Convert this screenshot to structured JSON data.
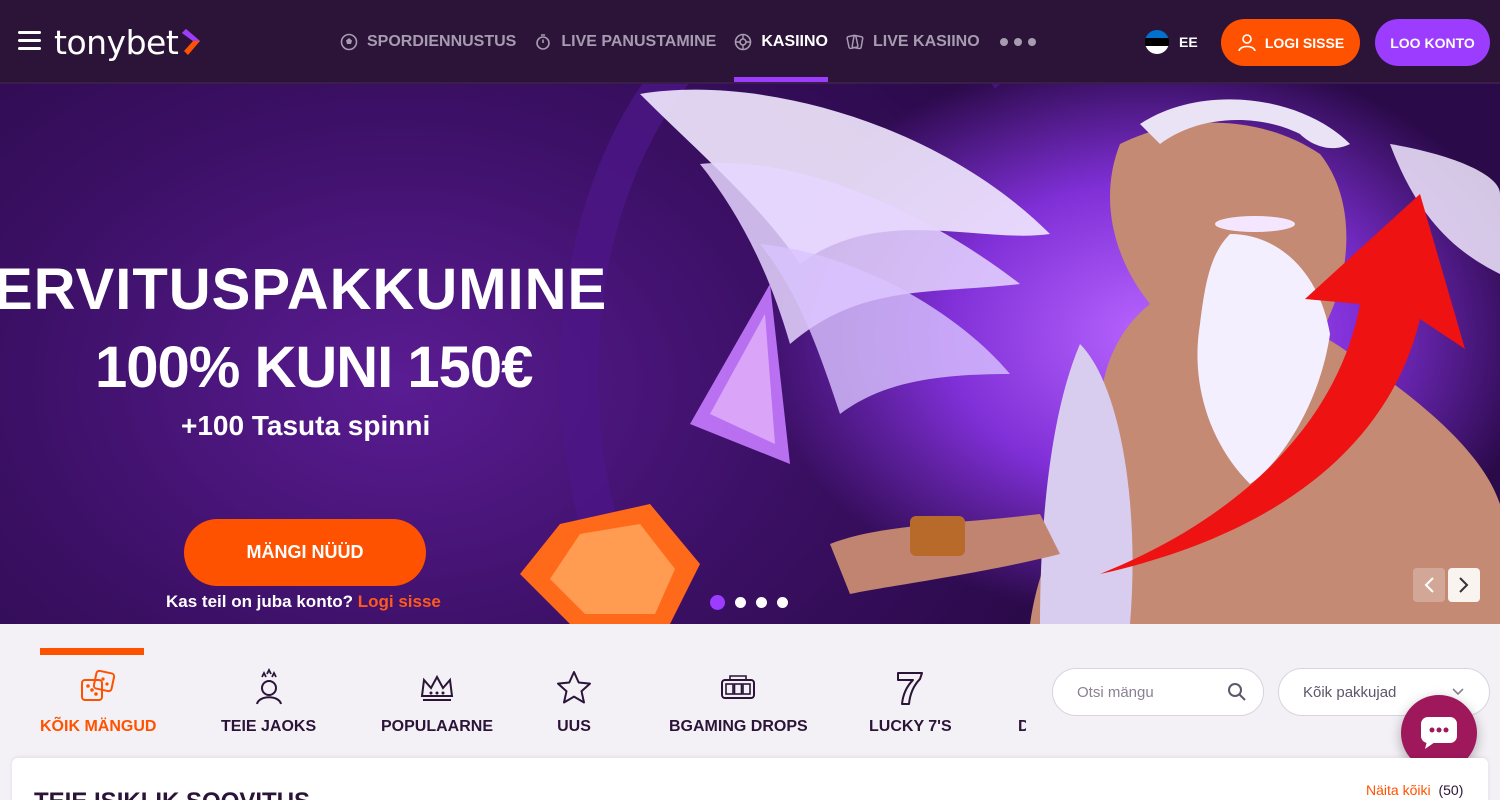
{
  "header": {
    "logo": "tonybet",
    "nav": [
      {
        "label": "SPORDIENNUSTUS",
        "icon": "soccer-ball-icon",
        "active": false
      },
      {
        "label": "LIVE PANUSTAMINE",
        "icon": "stopwatch-icon",
        "active": false
      },
      {
        "label": "KASIINO",
        "icon": "roulette-icon",
        "active": true
      },
      {
        "label": "LIVE KASIINO",
        "icon": "cards-icon",
        "active": false
      }
    ],
    "language": "EE",
    "login_label": "LOGI SISSE",
    "register_label": "LOO KONTO"
  },
  "hero": {
    "title": "ERVITUSPAKKUMINE",
    "amount": "100% KUNI 150€",
    "spins": "+100 Tasuta spinni",
    "cta": "MÄNGI NÜÜD",
    "account_question": "Kas teil on juba konto?",
    "account_link": "Logi sisse",
    "slides": 4,
    "active_slide": 1
  },
  "categories": [
    {
      "label": "KÕIK MÄNGUD",
      "icon": "dice-icon",
      "active": true
    },
    {
      "label": "TEIE JAOKS",
      "icon": "user-star-icon",
      "active": false
    },
    {
      "label": "POPULAARNE",
      "icon": "crown-icon",
      "active": false
    },
    {
      "label": "UUS",
      "icon": "star-icon",
      "active": false
    },
    {
      "label": "BGAMING DROPS",
      "icon": "slot-machine-icon",
      "active": false
    },
    {
      "label": "LUCKY 7'S",
      "icon": "seven-icon",
      "active": false
    },
    {
      "label": "D",
      "icon": "",
      "active": false
    }
  ],
  "search": {
    "placeholder": "Otsi mängu"
  },
  "provider": {
    "selected": "Kõik pakkujad"
  },
  "recommendations": {
    "title": "TEIE ISIKLIK SOOVITUS",
    "link": "Näita kõiki",
    "count": "(50)"
  },
  "colors": {
    "brand_orange": "#ff5200",
    "brand_purple": "#9b3cff",
    "header_bg": "#2b1438"
  }
}
